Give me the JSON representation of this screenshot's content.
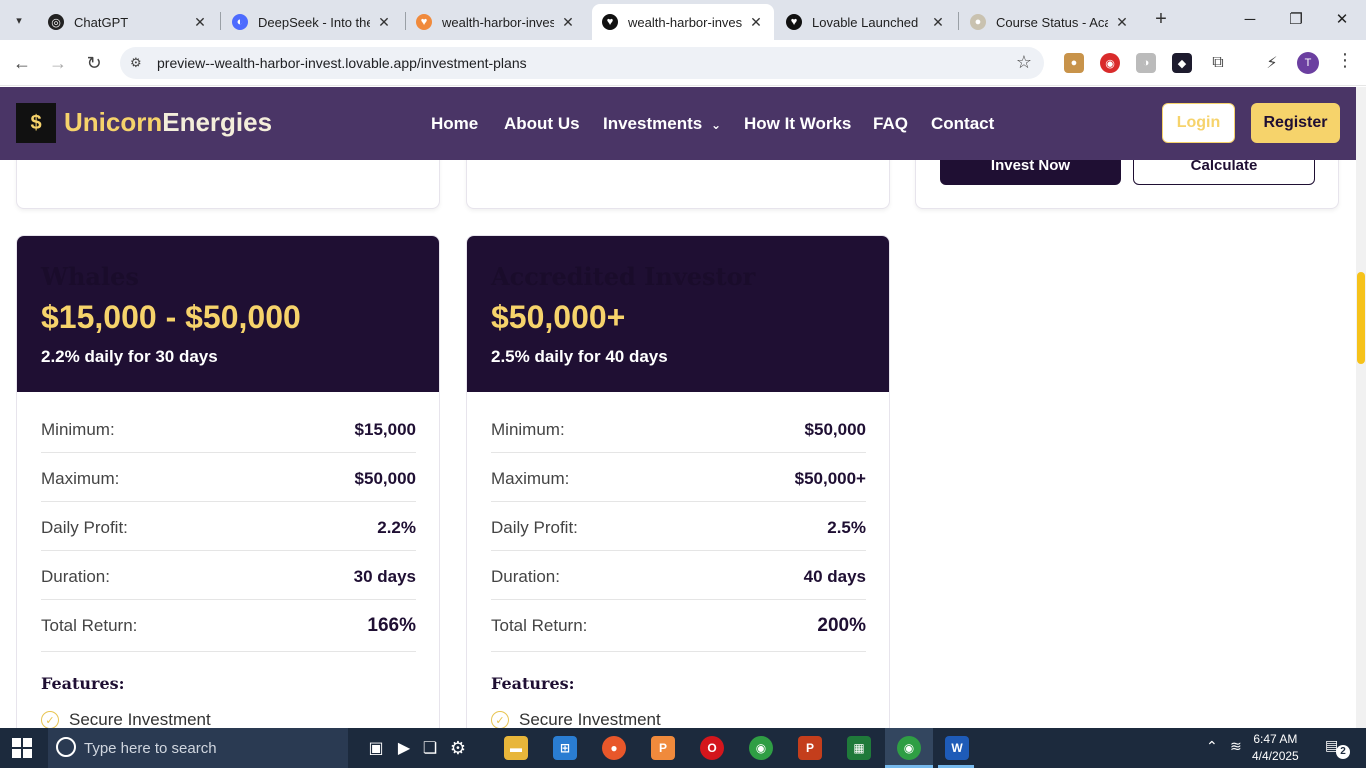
{
  "browser": {
    "tabs": [
      {
        "title": "ChatGPT",
        "active": false
      },
      {
        "title": "DeepSeek - Into the U",
        "active": false
      },
      {
        "title": "wealth-harbor-invest",
        "active": false
      },
      {
        "title": "wealth-harbor-invest",
        "active": true
      },
      {
        "title": "Lovable Launched",
        "active": false
      },
      {
        "title": "Course Status - Acade",
        "active": false
      }
    ],
    "url": "preview--wealth-harbor-invest.lovable.app/investment-plans",
    "profile_initial": "T"
  },
  "site": {
    "logo_part1": "Unicorn",
    "logo_part2": "Energies",
    "nav": [
      {
        "label": "Home"
      },
      {
        "label": "About Us"
      },
      {
        "label": "Investments"
      },
      {
        "label": "How It Works"
      },
      {
        "label": "FAQ"
      },
      {
        "label": "Contact"
      }
    ],
    "login_label": "Login",
    "register_label": "Register"
  },
  "prev_row": {
    "invest_label": "Invest Now",
    "calculate_label": "Calculate"
  },
  "plans": [
    {
      "name": "Whales",
      "range": "$15,000 - $50,000",
      "rate": "2.2% daily for 30 days",
      "rows": [
        {
          "label": "Minimum:",
          "value": "$15,000"
        },
        {
          "label": "Maximum:",
          "value": "$50,000"
        },
        {
          "label": "Daily Profit:",
          "value": "2.2%"
        },
        {
          "label": "Duration:",
          "value": "30 days"
        },
        {
          "label": "Total Return:",
          "value": "166%"
        }
      ],
      "features_title": "Features:",
      "features": [
        "Secure Investment"
      ]
    },
    {
      "name": "Accredited Investor",
      "range": "$50,000+",
      "rate": "2.5% daily for 40 days",
      "rows": [
        {
          "label": "Minimum:",
          "value": "$50,000"
        },
        {
          "label": "Maximum:",
          "value": "$50,000+"
        },
        {
          "label": "Daily Profit:",
          "value": "2.5%"
        },
        {
          "label": "Duration:",
          "value": "40 days"
        },
        {
          "label": "Total Return:",
          "value": "200%"
        }
      ],
      "features_title": "Features:",
      "features": [
        "Secure Investment"
      ]
    }
  ],
  "taskbar": {
    "search_placeholder": "Type here to search",
    "time": "6:47 AM",
    "date": "4/4/2025",
    "notification_count": "2"
  },
  "colors": {
    "nav_bg": "#4a3566",
    "plan_header_bg": "#1f0f33",
    "accent_gold": "#f6d36b"
  }
}
